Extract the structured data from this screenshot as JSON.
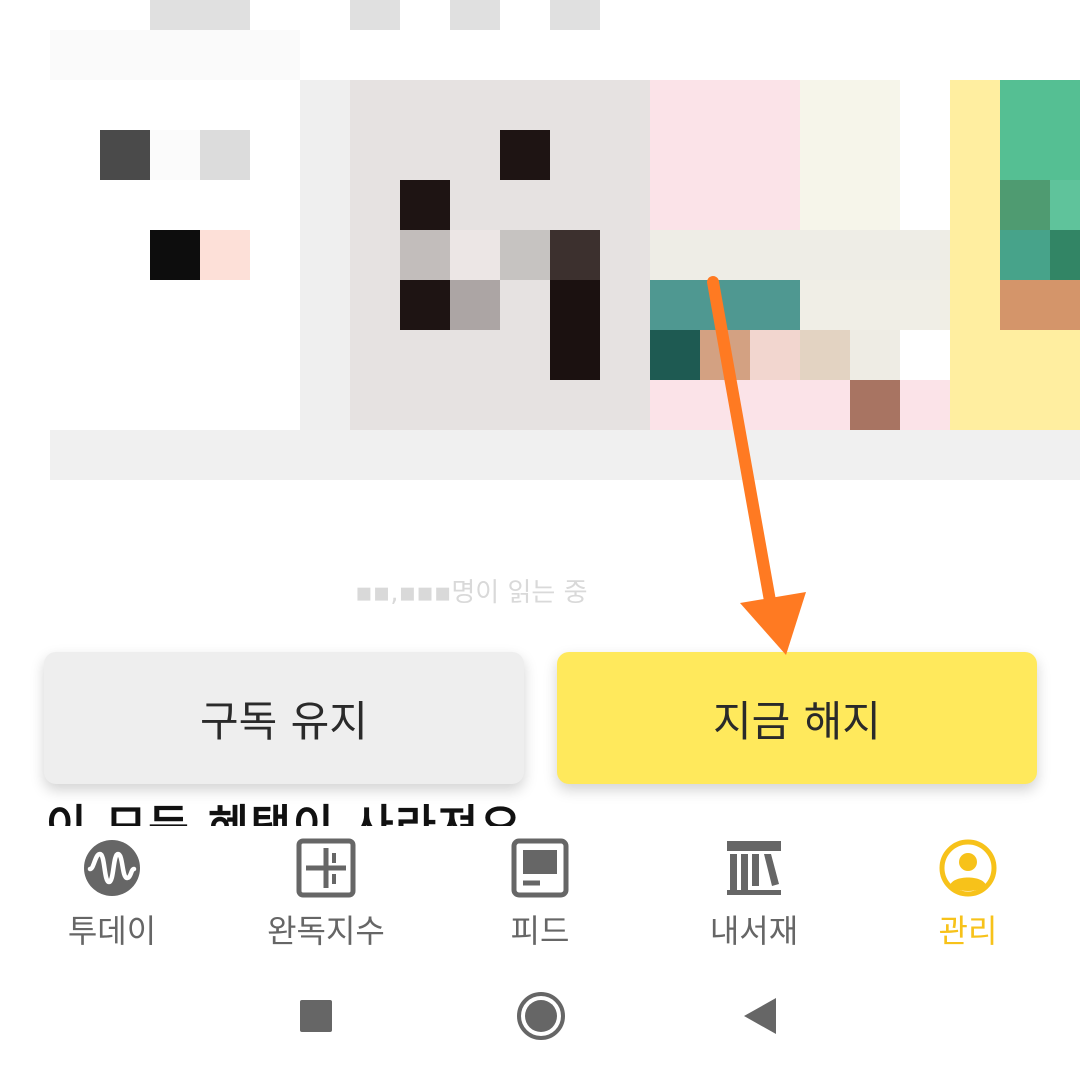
{
  "dialog": {
    "keep_label": "구독 유지",
    "cancel_label": "지금 해지"
  },
  "background": {
    "partial_line_1": "이 모든 혜택이 사라져요"
  },
  "bottom_nav": {
    "items": [
      {
        "label": "투데이",
        "icon": "today-wave-icon"
      },
      {
        "label": "완독지수",
        "icon": "plus-square-icon"
      },
      {
        "label": "피드",
        "icon": "feed-icon"
      },
      {
        "label": "내서재",
        "icon": "bookshelf-icon"
      },
      {
        "label": "관리",
        "icon": "profile-icon",
        "active": true
      }
    ]
  },
  "colors": {
    "accent_yellow": "#ffe95c",
    "active_nav": "#f7c21a",
    "inactive_nav": "#666666",
    "annotation_arrow": "#ff7a22"
  },
  "system_nav": {
    "icons": [
      "recents-square-icon",
      "home-circle-icon",
      "back-triangle-icon"
    ]
  }
}
